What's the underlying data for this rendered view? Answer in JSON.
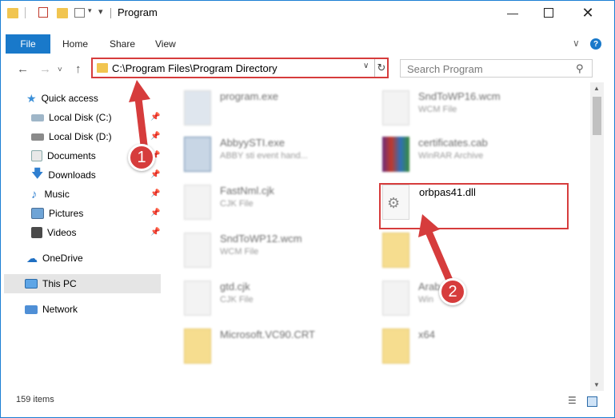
{
  "window": {
    "title": "Program"
  },
  "ribbon": {
    "file_label": "File",
    "tabs": [
      {
        "label": "Home"
      },
      {
        "label": "Share"
      },
      {
        "label": "View"
      }
    ],
    "help_label": "?"
  },
  "address": {
    "path": "C:\\Program Files\\Program Directory"
  },
  "search": {
    "placeholder": "Search Program"
  },
  "nav": {
    "quick_access": "Quick access",
    "items": [
      {
        "label": "Local Disk (C:)"
      },
      {
        "label": "Local Disk (D:)"
      },
      {
        "label": "Documents"
      },
      {
        "label": "Downloads"
      },
      {
        "label": "Music"
      },
      {
        "label": "Pictures"
      },
      {
        "label": "Videos"
      }
    ],
    "onedrive": "OneDrive",
    "this_pc": "This PC",
    "network": "Network"
  },
  "files": [
    {
      "name": "program.exe",
      "sub": ""
    },
    {
      "name": "SndToWP16.wcm",
      "sub": "WCM File"
    },
    {
      "name": "AbbyySTI.exe",
      "sub": "ABBY sti event hand..."
    },
    {
      "name": "certificates.cab",
      "sub": "WinRAR Archive"
    },
    {
      "name": "FastNml.cjk",
      "sub": "CJK File"
    },
    {
      "name": "orbpas41.dll",
      "sub": ""
    },
    {
      "name": "SndToWP12.wcm",
      "sub": "WCM File"
    },
    {
      "name": "gtd.cjk",
      "sub": "CJK File"
    },
    {
      "name": "Arab",
      "sub": "Win"
    },
    {
      "name": "Microsoft.VC90.CRT",
      "sub": ""
    },
    {
      "name": "x64",
      "sub": ""
    }
  ],
  "status": {
    "item_count": "159 items"
  },
  "annotations": {
    "step1": "1",
    "step2": "2"
  },
  "colors": {
    "accent": "#1979ca",
    "highlight": "#d63c3c"
  }
}
